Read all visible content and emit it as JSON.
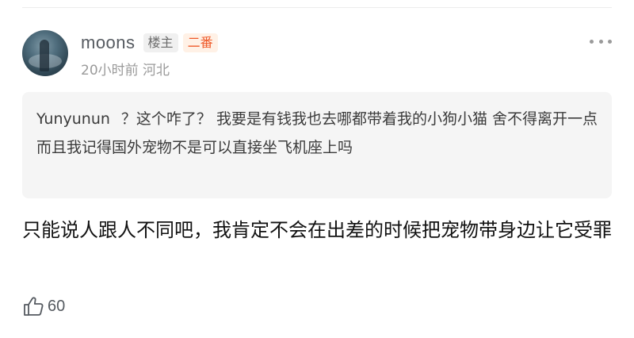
{
  "comment": {
    "username": "moons",
    "owner_badge": "楼主",
    "rank_badge": "二番",
    "time": "20小时前",
    "location": "河北",
    "quote": {
      "author": "Yunyunun",
      "text": "？这个咋了？ 我要是有钱我也去哪都带着我的小狗小猫 舍不得离开一点 而且我记得国外宠物不是可以直接坐飞机座上吗"
    },
    "body": "只能说人跟人不同吧，我肯定不会在出差的时候把宠物带身边让它受罪",
    "likes": "60"
  },
  "icons": {
    "more": "more-dots-icon",
    "like": "thumbs-up-icon"
  },
  "colors": {
    "badge_owner_bg": "#f0f0f0",
    "badge_rank_bg": "#fff1e6",
    "badge_rank_text": "#ef5a2a",
    "quote_bg": "#f5f5f5",
    "meta_text": "#9a9a9a"
  }
}
